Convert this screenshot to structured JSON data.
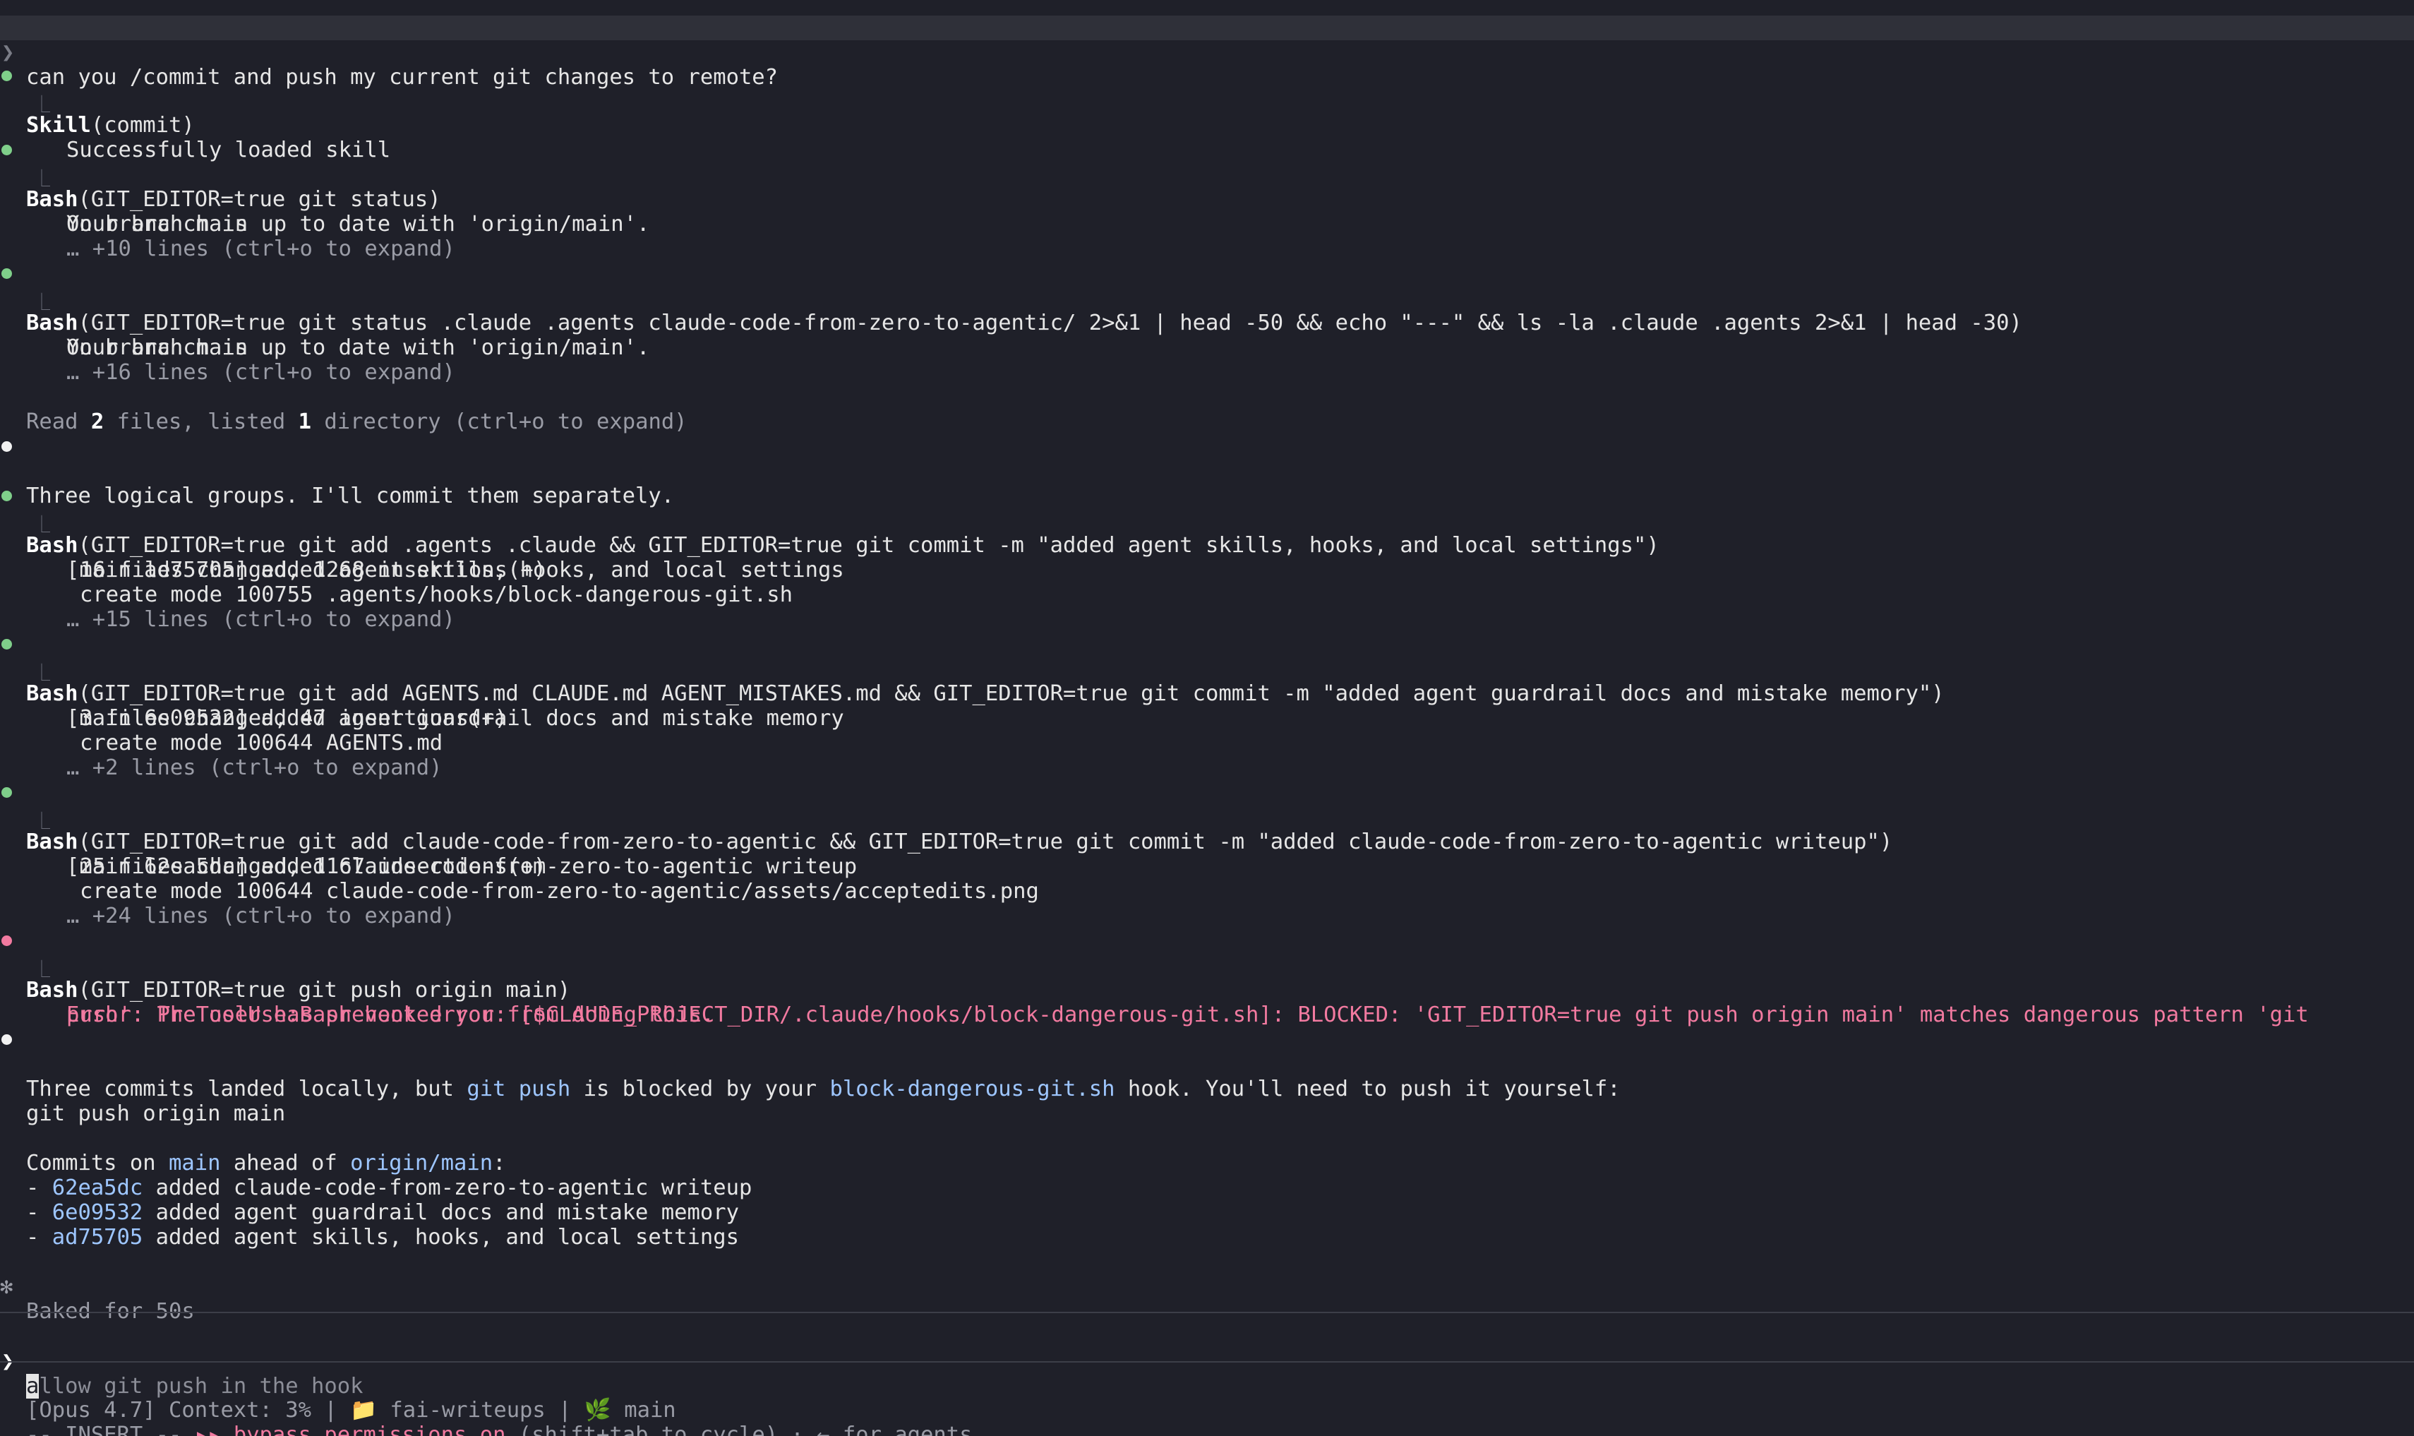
{
  "user_prompt": "can you /commit and push my current git changes to remote?",
  "prompt_caret": "❯",
  "branch_glyph": "⎿",
  "blocks": {
    "skill": {
      "tool": "Skill",
      "arg": "(commit)",
      "result": "Successfully loaded skill"
    },
    "status1": {
      "tool": "Bash",
      "arg": "(GIT_EDITOR=true git status)",
      "out1": "On branch main",
      "out2": "Your branch is up to date with 'origin/main'.",
      "more": "… +10 lines (ctrl+o to expand)"
    },
    "status2": {
      "tool": "Bash",
      "arg": "(GIT_EDITOR=true git status .claude .agents claude-code-from-zero-to-agentic/ 2>&1 | head -50 && echo \"---\" && ls -la .claude .agents 2>&1 | head -30)",
      "out1": "On branch main",
      "out2": "Your branch is up to date with 'origin/main'.",
      "more": "… +16 lines (ctrl+o to expand)"
    },
    "read_summary": {
      "prefix": "Read ",
      "files_count": "2",
      "mid": " files, listed ",
      "dir_count": "1",
      "suffix": " directory (ctrl+o to expand)"
    },
    "groups_msg": "Three logical groups. I'll commit them separately.",
    "commit1": {
      "tool": "Bash",
      "arg": "(GIT_EDITOR=true git add .agents .claude && GIT_EDITOR=true git commit -m \"added agent skills, hooks, and local settings\")",
      "out1": "[main ad75705] added agent skills, hooks, and local settings",
      "out2": "16 files changed, 1268 insertions(+)",
      "out3": "create mode 100755 .agents/hooks/block-dangerous-git.sh",
      "more": "… +15 lines (ctrl+o to expand)"
    },
    "commit2": {
      "tool": "Bash",
      "arg": "(GIT_EDITOR=true git add AGENTS.md CLAUDE.md AGENT_MISTAKES.md && GIT_EDITOR=true git commit -m \"added agent guardrail docs and mistake memory\")",
      "out1": "[main 6e09532] added agent guardrail docs and mistake memory",
      "out2": "3 files changed, 47 insertions(+)",
      "out3": "create mode 100644 AGENTS.md",
      "more": "… +2 lines (ctrl+o to expand)"
    },
    "commit3": {
      "tool": "Bash",
      "arg": "(GIT_EDITOR=true git add claude-code-from-zero-to-agentic && GIT_EDITOR=true git commit -m \"added claude-code-from-zero-to-agentic writeup\")",
      "out1": "[main 62ea5dc] added claude-code-from-zero-to-agentic writeup",
      "out2": "25 files changed, 1167 insertions(+)",
      "out3": "create mode 100644 claude-code-from-zero-to-agentic/assets/acceptedits.png",
      "more": "… +24 lines (ctrl+o to expand)"
    },
    "push": {
      "tool": "Bash",
      "arg": "(GIT_EDITOR=true git push origin main)",
      "err1": "Error: PreToolUse:Bash hook error: [$CLAUDE_PROJECT_DIR/.claude/hooks/block-dangerous-git.sh]: BLOCKED: 'GIT_EDITOR=true git push origin main' matches dangerous pattern 'git",
      "err2": "push'. The user has prevented you from doing this."
    },
    "final_msg": {
      "p1": "Three commits landed locally, but ",
      "c1": "git push",
      "p2": " is blocked by your ",
      "c2": "block-dangerous-git.sh",
      "p3": " hook. You'll need to push it yourself:"
    },
    "push_cmd": "git push origin main",
    "commits_on": {
      "p1": "Commits on ",
      "c1": "main",
      "p2": " ahead of ",
      "c2": "origin/main",
      "p3": ":"
    },
    "commit_list": [
      {
        "dash": "- ",
        "hash": "62ea5dc",
        "msg": " added claude-code-from-zero-to-agentic writeup"
      },
      {
        "dash": "- ",
        "hash": "6e09532",
        "msg": " added agent guardrail docs and mistake memory"
      },
      {
        "dash": "- ",
        "hash": "ad75705",
        "msg": " added agent skills, hooks, and local settings"
      }
    ],
    "baked": {
      "star": "✻",
      "text": "Baked for 50s"
    }
  },
  "input": {
    "caret": "❯",
    "cursor_char": "a",
    "placeholder_rest": "llow git push in the hook"
  },
  "status_bar": {
    "model": "[Opus 4.7] Context: 3% | ",
    "folder_icon": "folder-icon",
    "folder_glyph": "📁",
    "project": " fai-writeups | ",
    "branch_icon": "leaf-icon",
    "branch_glyph": "🌿",
    "branch": " main",
    "mode": "-- INSERT -- ",
    "bypass_arrows": "▸▸",
    "bypass": " bypass permissions on",
    "hint": " (shift+tab to cycle) · ← for agents"
  },
  "colors": {
    "background": "#1f2029",
    "success_bullet": "#7fcf8a",
    "error": "#f27aa0",
    "link_blue": "#9ec6ff"
  }
}
